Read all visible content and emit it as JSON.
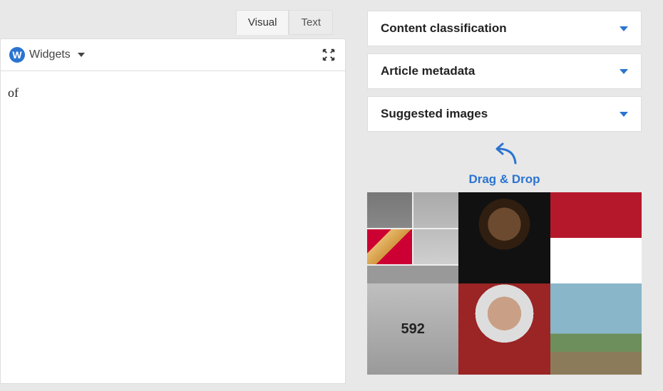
{
  "editor": {
    "tabs": {
      "visual": "Visual",
      "text": "Text"
    },
    "toolbar": {
      "widgets_label": "Widgets"
    },
    "body_fragment": "of"
  },
  "sidebar": {
    "panels": {
      "classification": "Content classification",
      "metadata": "Article metadata",
      "suggested": "Suggested images"
    },
    "hint": "Drag & Drop",
    "runner_bib": "592"
  }
}
